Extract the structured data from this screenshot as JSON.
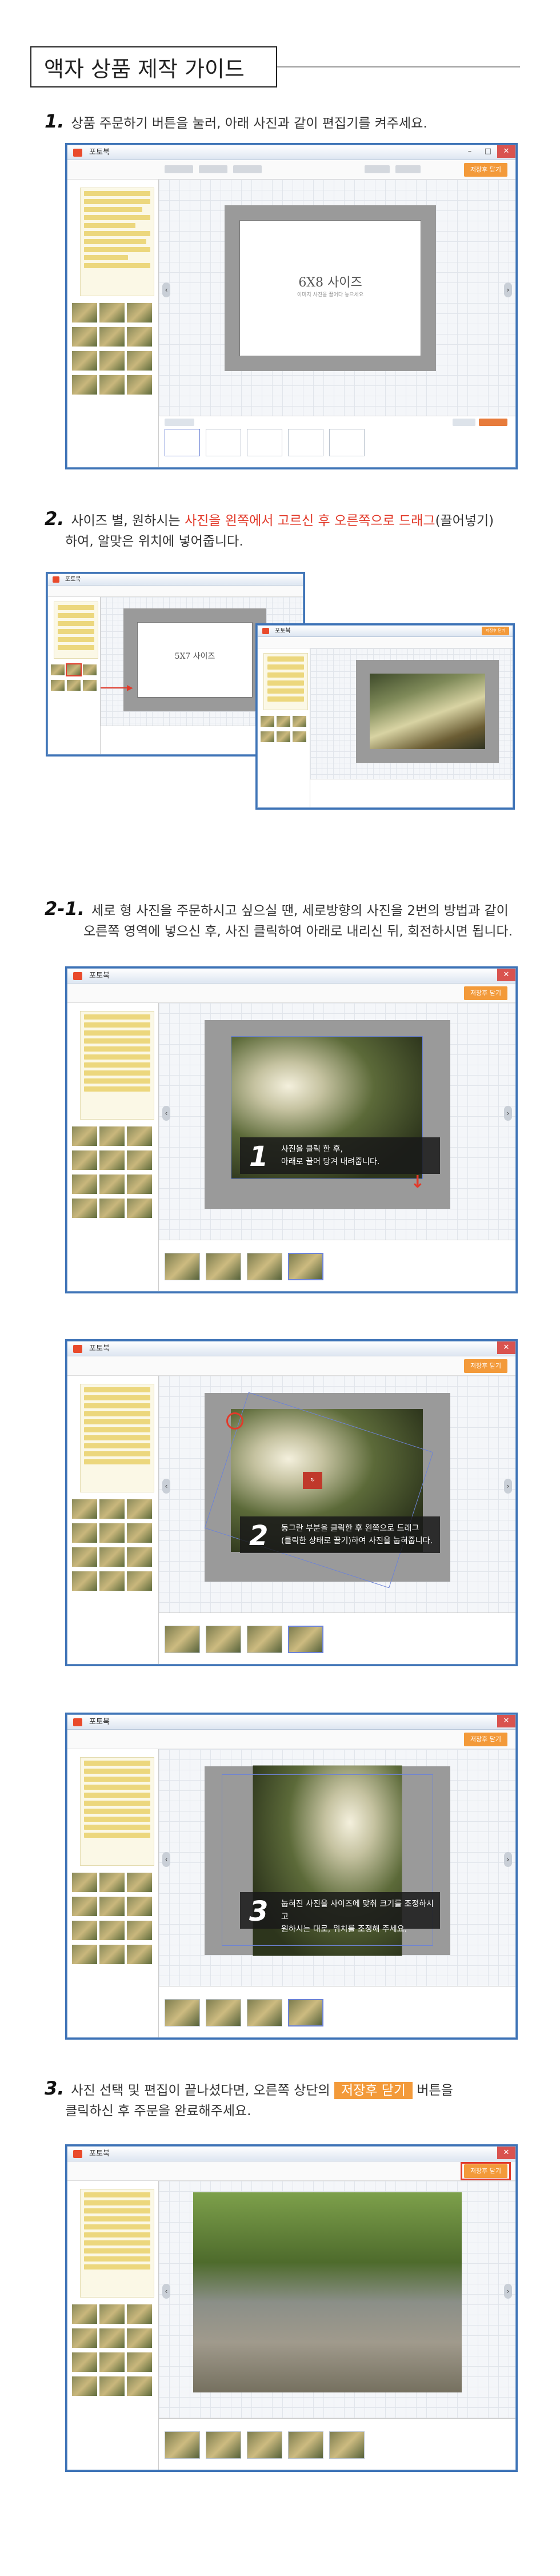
{
  "page": {
    "title": "액자 상품 제작 가이드"
  },
  "editor": {
    "window_title": "포토북",
    "save_button": "저장후 닫기",
    "frame_6x8": "6X8 사이즈",
    "frame_5x7": "5X7 사이즈",
    "frame_hint": "이미지 사진을 끌어다 놓으세요"
  },
  "steps": {
    "s1": {
      "num": "1.",
      "text": "상품 주문하기 버튼을 눌러, 아래 사진과 같이 편집기를 켜주세요."
    },
    "s2": {
      "num": "2.",
      "line1_pre": "사이즈 별, 원하시는 ",
      "line1_red": "사진을 왼쪽에서 고르신 후 오른쪽으로 드래그",
      "line1_post": "(끌어넣기)",
      "line2": "하여, 알맞은 위치에 넣어줍니다."
    },
    "s21": {
      "num": "2-1.",
      "line1": "세로 형 사진을 주문하시고 싶으실 땐, 세로방향의 사진을 2번의 방법과 같이",
      "line2": "오른쪽 영역에 넣으신 후, 사진 클릭하여 아래로 내리신 뒤, 회전하시면 됩니다."
    },
    "s3": {
      "num": "3.",
      "line1_pre": "사진 선택 및 편집이 끝나셨다면, 오른쪽 상단의",
      "line1_badge": "저장후 닫기",
      "line1_post": "버튼을",
      "line2": "클릭하신 후 주문을 완료해주세요."
    }
  },
  "notes": {
    "n1": {
      "num": "1",
      "l1": "사진을 클릭 한 후,",
      "l2": "아래로 끌어 당겨 내려줍니다."
    },
    "n2": {
      "num": "2",
      "l1": "동그란 부분을 클릭한 후 왼쪽으로 드래그",
      "l2": "(클릭한 상태로 끌기)하여 사진을 눕혀줍니다."
    },
    "n3": {
      "num": "3",
      "l1": "눕혀진 사진을 사이즈에 맞춰 크기를 조정하시고",
      "l2": "원하시는 대로, 위치를 조정해 주세요."
    }
  },
  "colors": {
    "accent": "#f39a3a",
    "highlight_red": "#e23a2a",
    "window_border": "#3f74b7"
  }
}
